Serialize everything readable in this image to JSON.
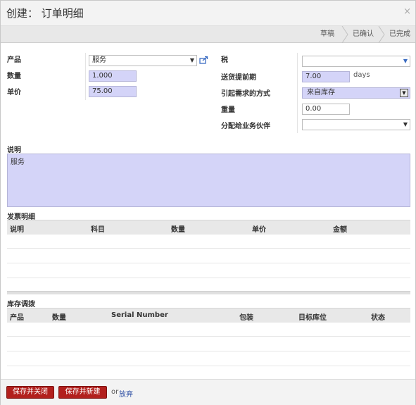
{
  "dialog": {
    "title": "创建： 订单明细",
    "close": "×"
  },
  "statusbar": {
    "stages": [
      "草稿",
      "已确认",
      "已完成"
    ]
  },
  "form": {
    "product_label": "产品",
    "product_value": "服务",
    "quantity_label": "数量",
    "quantity_value": "1.000",
    "unit_price_label": "单价",
    "unit_price_value": "75.00",
    "tax_label": "税",
    "tax_value": "",
    "delay_label": "送货提前期",
    "delay_value": "7.00",
    "delay_unit": "days",
    "procure_method_label": "引起需求的方式",
    "procure_method_value": "来自库存",
    "weight_label": "重量",
    "weight_value": "0.00",
    "assign_partner_label": "分配给业务伙伴",
    "assign_partner_value": ""
  },
  "note": {
    "label": "说明",
    "value": "服务"
  },
  "invoice_lines": {
    "title": "发票明细",
    "columns": [
      "说明",
      "科目",
      "数量",
      "单价",
      "金额"
    ]
  },
  "stock_moves": {
    "title": "库存调拨",
    "columns": [
      "产品",
      "数量",
      "Serial Number",
      "包装",
      "目标库位",
      "状态"
    ]
  },
  "footer": {
    "save_close": "保存并关闭",
    "save_new": "保存并新建",
    "or": "or",
    "discard": "放弃"
  },
  "colors": {
    "required_bg": "#d4d4f8",
    "primary_button": "#b2201d",
    "link": "#2b4ca2"
  }
}
